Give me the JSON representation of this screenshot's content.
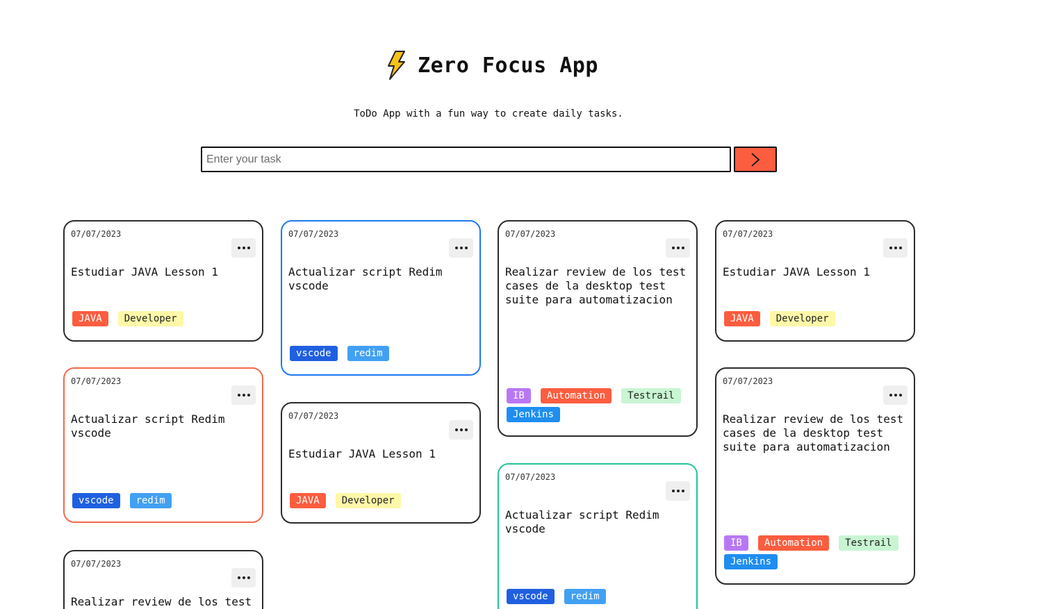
{
  "header": {
    "title": "Zero Focus App",
    "subtitle": "ToDo App with a fun way to create daily tasks.",
    "logo_icon": "lightning-bolt-icon"
  },
  "input": {
    "placeholder": "Enter your task",
    "value": "",
    "submit_icon": "chevron-right-icon"
  },
  "colors": {
    "accent": "#fb5d3f",
    "tag_java": "#fb5d3f",
    "tag_developer": "#fef8a8",
    "tag_vscode": "#2060e0",
    "tag_redim": "#42a0f2",
    "tag_ib": "#b878f5",
    "tag_automation": "#fb5d3f",
    "tag_testrail": "#c9f5d3",
    "tag_jenkins": "#1e8ef0"
  },
  "cards": [
    {
      "date": "07/07/2023",
      "text": "Estudiar JAVA Lesson 1",
      "tags": [
        "JAVA",
        "Developer"
      ]
    },
    {
      "date": "07/07/2023",
      "text": "Actualizar script Redim\nvscode",
      "tags": [
        "vscode",
        "redim"
      ]
    },
    {
      "date": "07/07/2023",
      "text": "Realizar review de los test\ncases de la desktop test\nsuite para automatizacion",
      "tags": [
        "IB",
        "Automation",
        "Testrail",
        "Jenkins"
      ]
    },
    {
      "date": "07/07/2023",
      "text": "Estudiar JAVA Lesson 1",
      "tags": [
        "JAVA",
        "Developer"
      ]
    },
    {
      "date": "07/07/2023",
      "text": "Actualizar script Redim\nvscode",
      "tags": [
        "vscode",
        "redim"
      ]
    },
    {
      "date": "07/07/2023",
      "text": "Estudiar JAVA Lesson 1",
      "tags": [
        "JAVA",
        "Developer"
      ]
    },
    {
      "date": "07/07/2023",
      "text": "Actualizar script Redim\nvscode",
      "tags": [
        "vscode",
        "redim"
      ]
    },
    {
      "date": "07/07/2023",
      "text": "Realizar review de los test\ncases de la desktop test\nsuite para automatizacion",
      "tags": [
        "IB",
        "Automation",
        "Testrail",
        "Jenkins"
      ]
    },
    {
      "date": "07/07/2023",
      "text": "Realizar review de los test",
      "tags": []
    }
  ]
}
